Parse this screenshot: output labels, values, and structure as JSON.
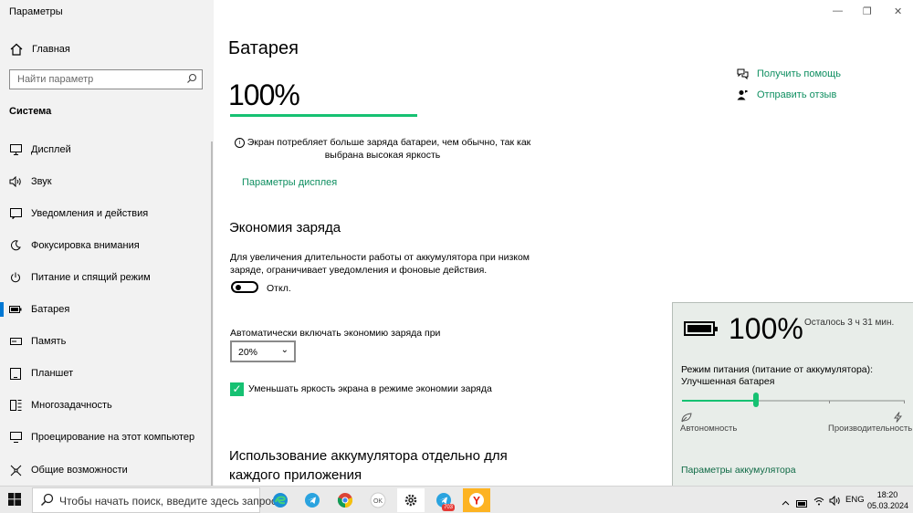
{
  "window": {
    "title": "Параметры"
  },
  "sidebar": {
    "home": "Главная",
    "search_placeholder": "Найти параметр",
    "section": "Система",
    "items": [
      {
        "label": "Дисплей",
        "icon": "monitor-icon"
      },
      {
        "label": "Звук",
        "icon": "speaker-icon"
      },
      {
        "label": "Уведомления и действия",
        "icon": "notification-icon"
      },
      {
        "label": "Фокусировка внимания",
        "icon": "moon-icon"
      },
      {
        "label": "Питание и спящий режим",
        "icon": "power-icon"
      },
      {
        "label": "Батарея",
        "icon": "battery-icon",
        "active": true
      },
      {
        "label": "Память",
        "icon": "storage-icon"
      },
      {
        "label": "Планшет",
        "icon": "tablet-icon"
      },
      {
        "label": "Многозадачность",
        "icon": "multitask-icon"
      },
      {
        "label": "Проецирование на этот компьютер",
        "icon": "project-icon"
      },
      {
        "label": "Общие возможности",
        "icon": "share-icon"
      }
    ]
  },
  "main": {
    "title": "Батарея",
    "percent": "100%",
    "battery_level": 1.0,
    "warning": "Экран потребляет больше заряда батареи, чем обычно, так как выбрана высокая яркость",
    "display_link": "Параметры дисплея",
    "saver": {
      "heading": "Экономия заряда",
      "desc": "Для увеличения длительности работы от аккумулятора при низком заряде, ограничивает уведомления и фоновые действия.",
      "toggle_state": "Откл.",
      "auto_label": "Автоматически включать экономию заряда при",
      "auto_value": "20%",
      "brightness_label": "Уменьшать яркость экрана в режиме экономии заряда",
      "brightness_checked": true
    },
    "usage_heading": "Использование аккумулятора отдельно для каждого приложения",
    "help": {
      "get_help": "Получить помощь",
      "feedback": "Отправить отзыв"
    }
  },
  "flyout": {
    "percent": "100%",
    "remaining": "Осталось 3 ч 31 мин.",
    "mode_line1": "Режим питания (питание от аккумулятора):",
    "mode_line2": "Улучшенная батарея",
    "slider_position": 0.33,
    "min_label": "Автономность",
    "max_label": "Производительность",
    "settings_link": "Параметры аккумулятора"
  },
  "taskbar": {
    "search_placeholder": "Чтобы начать поиск, введите здесь запрос",
    "apps": [
      "edge-icon",
      "telegram-icon",
      "chrome-icon",
      "ok-icon",
      "settings-gear-icon",
      "telegram-badge-icon",
      "yandex-browser-icon"
    ],
    "badge": "703",
    "lang": "ENG",
    "time": "18:20",
    "date": "05.03.2024"
  },
  "colors": {
    "accent": "#16c172",
    "link": "#0f8f61",
    "flyout_bg": "#e8ede9",
    "active_marker": "#0078d4"
  }
}
